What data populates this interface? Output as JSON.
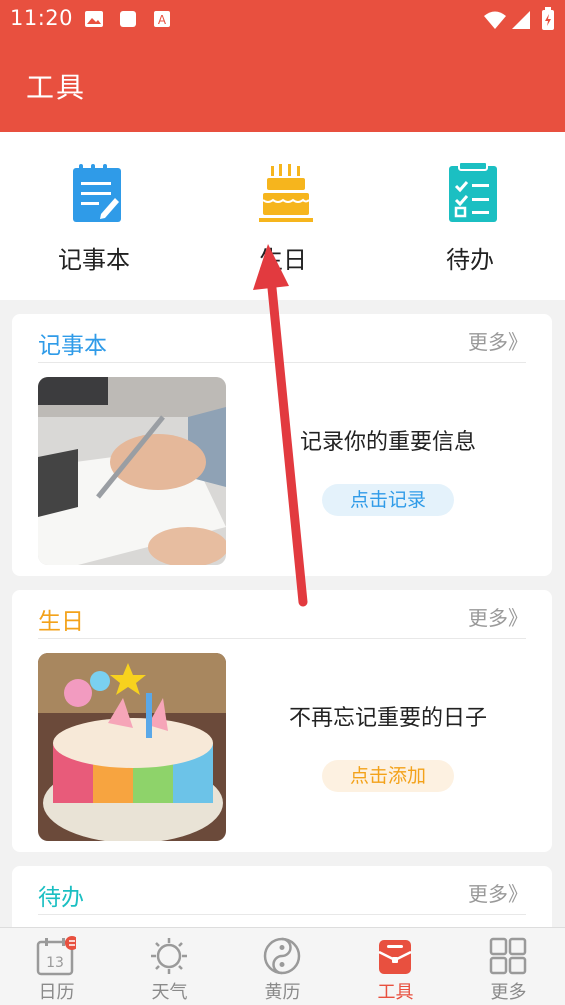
{
  "status_bar": {
    "time": "11:20"
  },
  "header": {
    "title": "工具"
  },
  "quick_tools": [
    {
      "label": "记事本",
      "icon": "notepad-icon",
      "color": "#2f9be8"
    },
    {
      "label": "生日",
      "icon": "birthday-cake-icon",
      "color": "#f6b51d"
    },
    {
      "label": "待办",
      "icon": "todo-checklist-icon",
      "color": "#1bbfc2"
    }
  ],
  "cards": {
    "notepad": {
      "title": "记事本",
      "more": "更多》",
      "description": "记录你的重要信息",
      "cta": "点击记录",
      "color": "#2f9be8"
    },
    "birthday": {
      "title": "生日",
      "more": "更多》",
      "description": "不再忘记重要的日子",
      "cta": "点击添加",
      "color": "#f3a21a"
    },
    "todo": {
      "title": "待办",
      "more": "更多》",
      "color": "#1bbfc2"
    }
  },
  "bottom_nav": [
    {
      "label": "日历",
      "icon": "calendar-icon",
      "badge_day": "13"
    },
    {
      "label": "天气",
      "icon": "sun-icon"
    },
    {
      "label": "黄历",
      "icon": "yin-yang-icon"
    },
    {
      "label": "工具",
      "icon": "toolbox-icon",
      "active": true
    },
    {
      "label": "更多",
      "icon": "grid-icon"
    }
  ],
  "accent_color": "#e8503f"
}
